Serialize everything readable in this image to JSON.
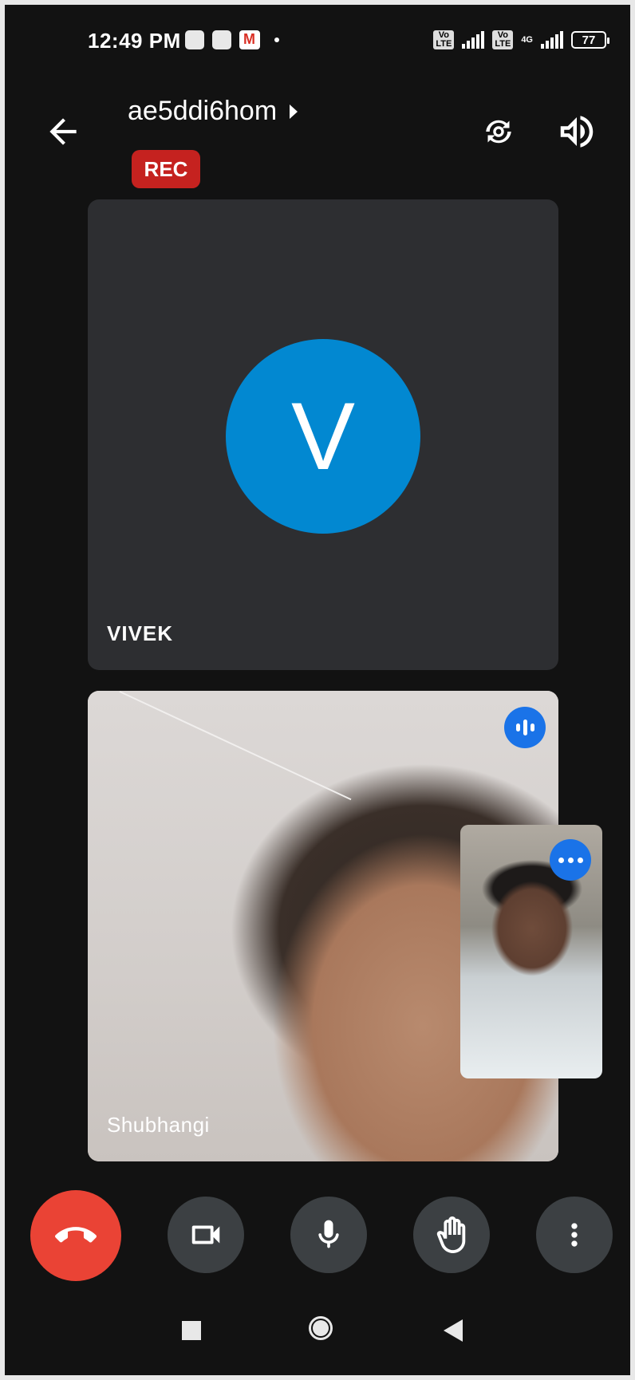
{
  "status_bar": {
    "time": "12:49 PM",
    "battery": "77",
    "network_label": "4G",
    "volte_label": "Vo\nLTE"
  },
  "header": {
    "meeting_code": "ae5ddi6hom",
    "rec_badge": "REC"
  },
  "participants": [
    {
      "name": "VIVEK",
      "initial": "V",
      "avatar_color": "#0288d1"
    },
    {
      "name": "Shubhangi"
    }
  ],
  "colors": {
    "end_call": "#ea4335",
    "rec": "#c5221f",
    "audio_indicator": "#1a73e8",
    "control_bg": "#3c4043"
  },
  "controls": {
    "end_call_icon": "end-call-icon",
    "camera_icon": "video-camera-icon",
    "mic_icon": "microphone-icon",
    "hand_icon": "raise-hand-icon",
    "more_icon": "more-vert-icon"
  }
}
